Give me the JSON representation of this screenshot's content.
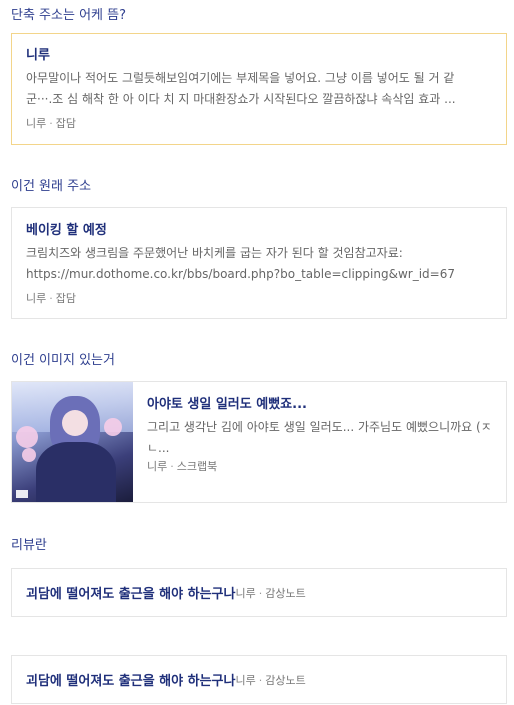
{
  "sections": [
    {
      "heading": "단축 주소는 어케 뜸?",
      "card": {
        "title": "니루",
        "desc_lines": [
          "아무말이나 적어도 그럴듯해보임여기에는 부제목을 넣어요. 그냥 이름 넣어도 될 거 같",
          "군···.조 심 해착 한 아 이다 치 지 마대환장쇼가 시작된다오 깔끔하잖냐 속삭임 효과 ..."
        ],
        "author": "니루",
        "separator": "·",
        "category": "잡담"
      }
    },
    {
      "heading": "이건 원래 주소",
      "card": {
        "title": "베이킹 할 예정",
        "desc_lines": [
          "크림치즈와 생크림을 주문했어난 바치케를 굽는 자가 된다 할 것임참고자료:",
          "https://mur.dothome.co.kr/bbs/board.php?bo_table=clipping&wr_id=67"
        ],
        "author": "니루",
        "separator": "·",
        "category": "잡담"
      }
    },
    {
      "heading": "이건 이미지 있는거",
      "card": {
        "title": "아야토 생일 일러도 예뻤죠...",
        "desc": "그리고 생각난 김에 아야토 생일 일러도... 가주님도 예뻤으니까요 (ㅈㄴ...",
        "author": "니루",
        "separator": "·",
        "category": "스크랩북",
        "image_alt": "illustration thumbnail"
      }
    },
    {
      "heading": "리뷰란",
      "cards": [
        {
          "title": "괴담에 떨어져도 출근을 해야 하는구나",
          "author": "니루",
          "separator": "·",
          "category": "감상노트"
        },
        {
          "title": "괴담에 떨어져도 출근을 해야 하는구나",
          "author": "니루",
          "separator": "·",
          "category": "감상노트"
        }
      ]
    }
  ],
  "colors": {
    "heading": "#2f3f8f",
    "title": "#1f2f7a",
    "highlight_border": "#f3d58a",
    "card_border": "#e5e5e5"
  }
}
